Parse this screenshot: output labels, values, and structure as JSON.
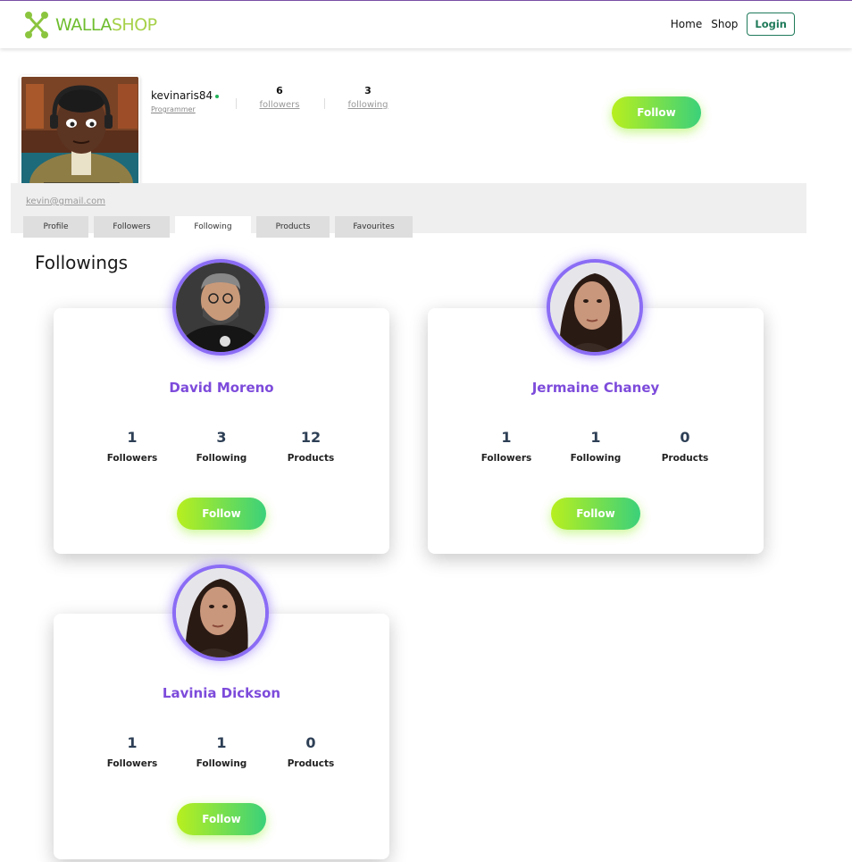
{
  "nav": {
    "logo_part1": "WALLA",
    "logo_part2": "SHOP",
    "links": [
      "Home",
      "Shop"
    ],
    "login_label": "Login"
  },
  "profile": {
    "username": "kevinaris84",
    "role": "Programmer",
    "followers_count": "6",
    "followers_label": "followers",
    "following_count": "3",
    "following_label": "following",
    "follow_label": "Follow",
    "email": "kevin@gmail.com"
  },
  "tabs": [
    {
      "label": "Profile"
    },
    {
      "label": "Followers"
    },
    {
      "label": "Following",
      "active": true
    },
    {
      "label": "Products"
    },
    {
      "label": "Favourites"
    }
  ],
  "section_title": "Followings",
  "cards": [
    {
      "name": "David Moreno",
      "followers": "1",
      "following": "3",
      "products": "12",
      "follow_label": "Follow"
    },
    {
      "name": "Jermaine Chaney",
      "followers": "1",
      "following": "1",
      "products": "0",
      "follow_label": "Follow"
    },
    {
      "name": "Lavinia Dickson",
      "followers": "1",
      "following": "1",
      "products": "0",
      "follow_label": "Follow"
    }
  ],
  "stat_labels": {
    "followers": "Followers",
    "following": "Following",
    "products": "Products"
  },
  "colors": {
    "accent_purple": "#7d4bdb",
    "ring_purple": "#8a6cf5",
    "gradient_start": "#b8ef1e",
    "gradient_end": "#3bd17a",
    "logo_green": "#6ebd2e"
  }
}
